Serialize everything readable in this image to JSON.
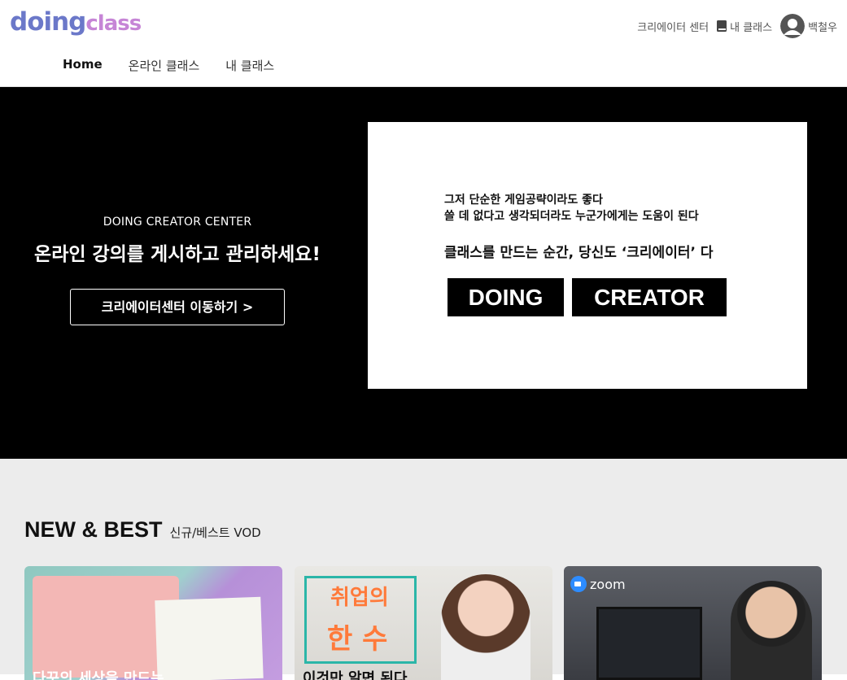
{
  "header": {
    "logo_part1": "doing",
    "logo_part2": "class",
    "links": {
      "creator_center": "크리에이터 센터",
      "my_class": "내 클래스",
      "username": "백철우"
    },
    "nav_tabs": [
      "Home",
      "온라인 클래스",
      "내 클래스"
    ],
    "active_tab": "Home"
  },
  "hero": {
    "kicker": "DOING CREATOR CENTER",
    "title": "온라인 강의를 게시하고 관리하세요!",
    "button": "크리에이터센터 이동하기 >",
    "banner": {
      "line1": "그저 단순한 게임공략이라도 좋다",
      "line2": "쓸 데 없다고 생각되더라도 누군가에게는 도움이 된다",
      "line3": "클래스를 만드는 순간, 당신도 ‘크리에이터’ 다",
      "box1": "DOING",
      "box2": "CREATOR"
    }
  },
  "section": {
    "title": "NEW & BEST",
    "subtitle": "신규/베스트 VOD",
    "cards": [
      {
        "caption": "다꾸의 세상을 만드는"
      },
      {
        "image_text_1": "취업의",
        "image_text_2": "한 수",
        "caption": "이것만 알면 된다"
      },
      {
        "logo": "zoom",
        "caption": ""
      }
    ]
  },
  "colors": {
    "logo_primary": "#6b78c9",
    "logo_secondary": "#c685d6",
    "hero_bg": "#000000",
    "section_bg": "#ececec",
    "zoom_blue": "#2d8cff"
  }
}
